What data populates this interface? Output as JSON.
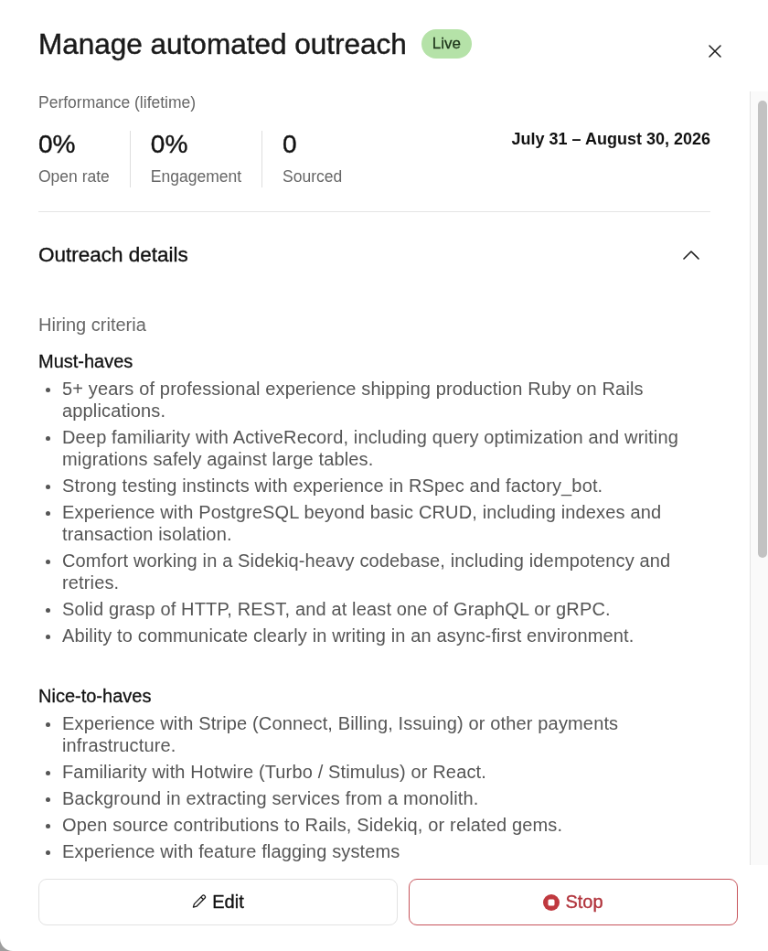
{
  "panel": {
    "title": "Manage automated outreach",
    "status_badge": "Live"
  },
  "performance": {
    "heading": "Performance (lifetime)",
    "stats": [
      {
        "value": "0%",
        "label": "Open rate"
      },
      {
        "value": "0%",
        "label": "Engagement"
      },
      {
        "value": "0",
        "label": "Sourced"
      }
    ],
    "date_range": "July 31 – August 30, 2026"
  },
  "outreach_details": {
    "title": "Outreach details",
    "expanded": true,
    "heading": "Hiring criteria",
    "groups": [
      {
        "title": "Must-haves",
        "items": [
          "5+ years of professional experience shipping production Ruby on Rails applications.",
          "Deep familiarity with ActiveRecord, including query optimization and writing migrations safely against large tables.",
          "Strong testing instincts with experience in RSpec and factory_bot.",
          "Experience with PostgreSQL beyond basic CRUD, including indexes and transaction isolation.",
          "Comfort working in a Sidekiq-heavy codebase, including idempotency and retries.",
          "Solid grasp of HTTP, REST, and at least one of GraphQL or gRPC.",
          "Ability to communicate clearly in writing in an async-first environment."
        ]
      },
      {
        "title": "Nice-to-haves",
        "items": [
          "Experience with Stripe (Connect, Billing, Issuing) or other payments infrastructure.",
          "Familiarity with Hotwire (Turbo / Stimulus) or React.",
          "Background in extracting services from a monolith.",
          "Open source contributions to Rails, Sidekiq, or related gems.",
          "Experience with feature flagging systems"
        ]
      }
    ]
  },
  "actions": [
    {
      "label": "Edit",
      "kind": "edit"
    },
    {
      "label": "Stop",
      "kind": "stop"
    }
  ]
}
